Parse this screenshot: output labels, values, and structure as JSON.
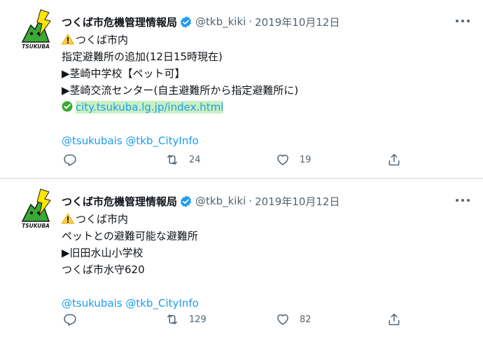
{
  "tweets": [
    {
      "author_name": "つくば市危機管理情報局",
      "handle": "@tkb_kiki",
      "separator": "·",
      "date": "2019年10月12日",
      "avatar_text": "TSUKUBA",
      "lines": {
        "l1": "つくば市内",
        "l2": "指定避難所の追加(12日15時現在)",
        "l3": "▶茎崎中学校【ペット可】",
        "l4": "▶茎崎交流センター(自主避難所から指定避難所に)",
        "link": "city.tsukuba.lg.jp/index.html"
      },
      "mentions": [
        "@tsukubais",
        "@tkb_CityInfo"
      ],
      "retweets": "24",
      "likes": "19"
    },
    {
      "author_name": "つくば市危機管理情報局",
      "handle": "@tkb_kiki",
      "separator": "·",
      "date": "2019年10月12日",
      "avatar_text": "TSUKUBA",
      "lines": {
        "l1": "つくば市内",
        "l2": "ペットとの避難可能な避難所",
        "l3": "▶旧田水山小学校",
        "l4": "つくば市水守620"
      },
      "mentions": [
        "@tsukubais",
        "@tkb_CityInfo"
      ],
      "retweets": "129",
      "likes": "82"
    }
  ],
  "colors": {
    "link": "#1d9bf0",
    "secondary_text": "#536471",
    "verified": "#1d9bf0",
    "link_highlight": "#c9f0c0"
  },
  "icons": [
    "verified-badge-icon",
    "more-options-icon",
    "warning-icon",
    "check-icon",
    "reply-icon",
    "retweet-icon",
    "like-icon",
    "share-icon"
  ]
}
